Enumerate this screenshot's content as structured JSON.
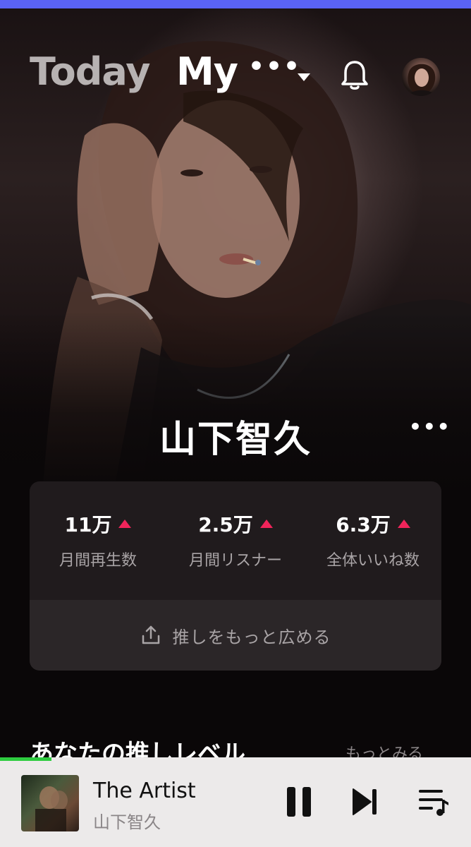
{
  "header": {
    "tab_today": "Today",
    "tab_my": "My",
    "tab_more": "•••",
    "notification_icon": "bell-icon",
    "avatar_icon": "profile-avatar"
  },
  "artist": {
    "name": "山下智久",
    "more": "•••"
  },
  "stats": [
    {
      "value": "11万",
      "label": "月間再生数"
    },
    {
      "value": "2.5万",
      "label": "月間リスナー"
    },
    {
      "value": "6.3万",
      "label": "全体いいね数"
    }
  ],
  "share": {
    "label": "推しをもっと広める",
    "icon": "share-icon"
  },
  "section": {
    "title": "あなたの推しレベル",
    "more": "もっとみる"
  },
  "player": {
    "title": "The Artist",
    "artist": "山下智久",
    "progress": 0.11,
    "controls": [
      "pause-icon",
      "skip-next-icon",
      "queue-icon"
    ]
  },
  "colors": {
    "accent_top": "#5a63f5",
    "up_arrow": "#f0245a",
    "progress": "#2ecc40",
    "card": "#201b1d"
  }
}
